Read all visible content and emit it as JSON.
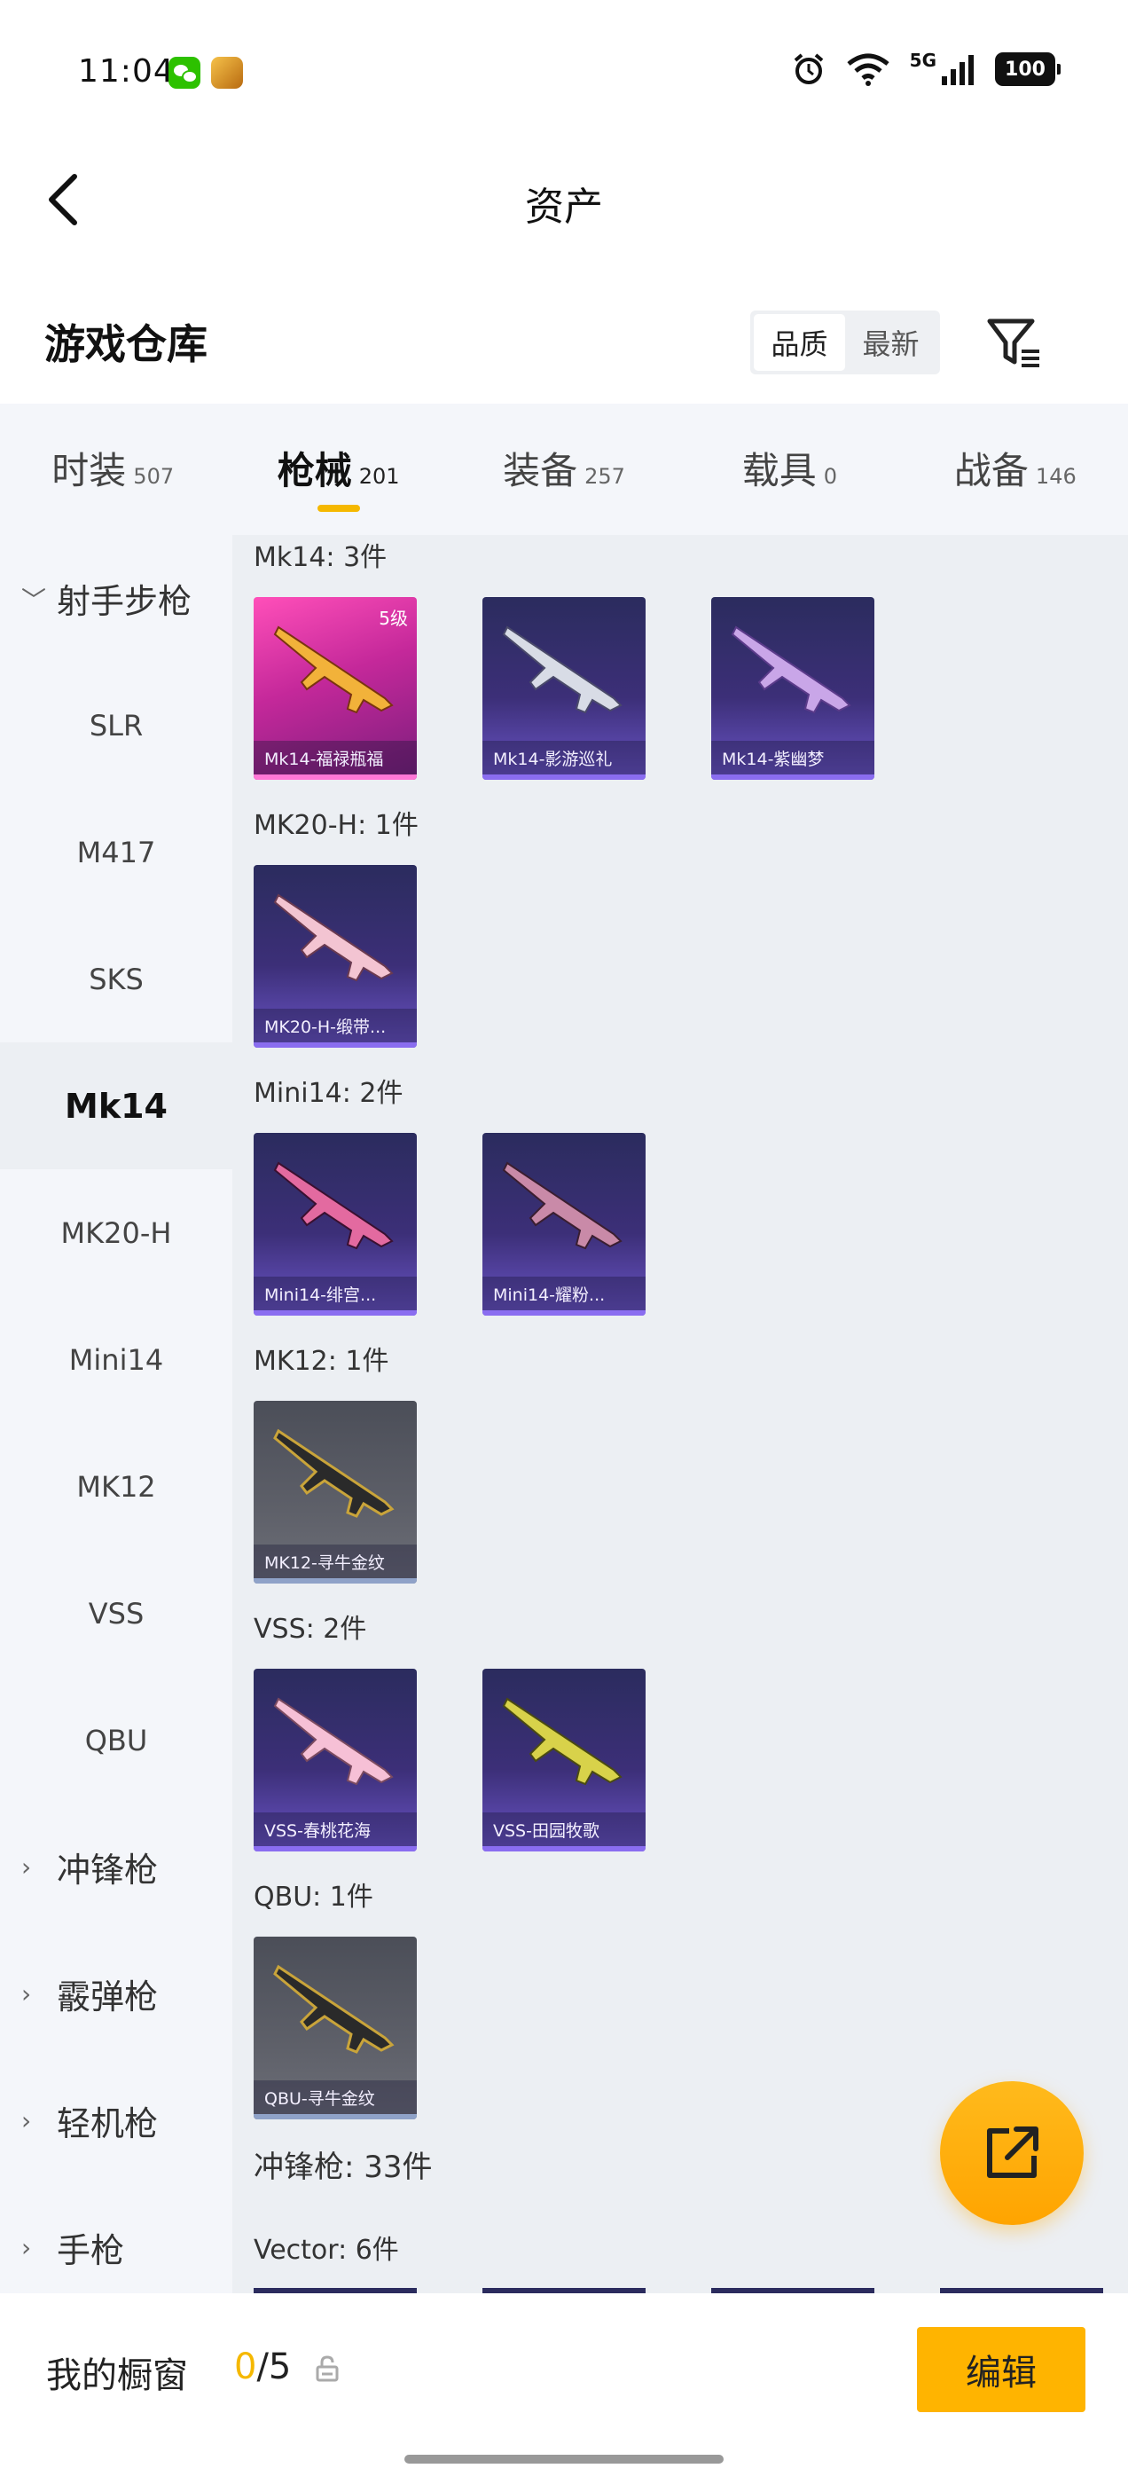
{
  "status_bar": {
    "time": "11:04",
    "network": "5G",
    "battery": "100"
  },
  "header": {
    "title": "资产"
  },
  "warehouse": {
    "title": "游戏仓库",
    "sort_options": [
      "品质",
      "最新"
    ]
  },
  "tabs": [
    {
      "label": "时装",
      "count": "507"
    },
    {
      "label": "枪械",
      "count": "201",
      "active": true
    },
    {
      "label": "装备",
      "count": "257"
    },
    {
      "label": "载具",
      "count": "0"
    },
    {
      "label": "战备",
      "count": "146"
    }
  ],
  "sidebar": {
    "group_open": "射手步枪",
    "items": [
      "SLR",
      "M417",
      "SKS",
      "Mk14",
      "MK20-H",
      "Mini14",
      "MK12",
      "VSS",
      "QBU"
    ],
    "active_item": "Mk14",
    "groups_closed": [
      "冲锋枪",
      "霰弹枪",
      "轻机枪",
      "手枪"
    ]
  },
  "sections": [
    {
      "label": "Mk14: 3件",
      "items": [
        {
          "name": "Mk14-福禄瓶福",
          "level": "5级",
          "rarity": "pink"
        },
        {
          "name": "Mk14-影游巡礼",
          "rarity": "purple"
        },
        {
          "name": "Mk14-紫幽梦",
          "rarity": "purple"
        }
      ]
    },
    {
      "label": "MK20-H: 1件",
      "items": [
        {
          "name": "MK20-H-缎带...",
          "rarity": "purple"
        }
      ]
    },
    {
      "label": "Mini14: 2件",
      "items": [
        {
          "name": "Mini14-绯宫...",
          "rarity": "purple"
        },
        {
          "name": "Mini14-耀粉...",
          "rarity": "purple"
        }
      ]
    },
    {
      "label": "MK12: 1件",
      "items": [
        {
          "name": "MK12-寻牛金纹",
          "rarity": "gray"
        }
      ]
    },
    {
      "label": "VSS: 2件",
      "items": [
        {
          "name": "VSS-春桃花海",
          "rarity": "purple"
        },
        {
          "name": "VSS-田园牧歌",
          "rarity": "purple"
        }
      ]
    },
    {
      "label": "QBU: 1件",
      "items": [
        {
          "name": "QBU-寻牛金纹",
          "rarity": "gray"
        }
      ]
    }
  ],
  "category_summary": "冲锋枪: 33件",
  "next_section_label": "Vector: 6件",
  "bottom": {
    "showcase_label": "我的橱窗",
    "showcase_current": "0",
    "showcase_total": "/5",
    "edit_label": "编辑"
  },
  "colors": {
    "accent": "#ffb400",
    "tab_indicator": "#f5b800"
  }
}
